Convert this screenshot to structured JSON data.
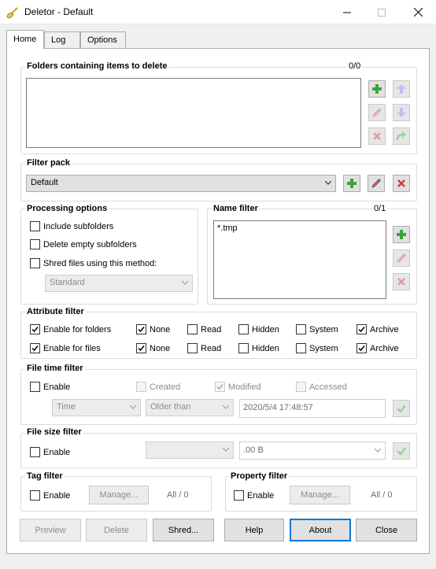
{
  "window": {
    "title": "Deletor - Default",
    "icon": "broom-icon",
    "controls": [
      "minimize-icon",
      "maximize-icon",
      "close-icon"
    ]
  },
  "tabs": [
    {
      "label": "Home",
      "active": true
    },
    {
      "label": "Log",
      "active": false
    },
    {
      "label": "Options",
      "active": false
    }
  ],
  "folders": {
    "title": "Folders containing items to delete",
    "count": "0/0",
    "items": []
  },
  "filter_pack": {
    "title": "Filter pack",
    "selected": "Default"
  },
  "processing": {
    "title": "Processing options",
    "include_subfolders": "Include subfolders",
    "delete_empty": "Delete empty subfolders",
    "shred": "Shred files using this method:",
    "method": "Standard"
  },
  "name_filter": {
    "title": "Name filter",
    "count": "0/1",
    "items": [
      "*.tmp"
    ]
  },
  "attribute_filter": {
    "title": "Attribute filter",
    "folders_label": "Enable for folders",
    "files_label": "Enable for files",
    "none": "None",
    "read": "Read",
    "hidden": "Hidden",
    "system": "System",
    "archive": "Archive"
  },
  "file_time": {
    "title": "File time filter",
    "enable": "Enable",
    "created": "Created",
    "modified": "Modified",
    "accessed": "Accessed",
    "unit": "Time",
    "comparison": "Older than",
    "datetime": "2020/5/4 17:48:57"
  },
  "file_size": {
    "title": "File size filter",
    "enable": "Enable",
    "comparison": "",
    "size": ".00 B"
  },
  "tag_filter": {
    "title": "Tag filter",
    "enable": "Enable",
    "manage": "Manage...",
    "value": "All / 0"
  },
  "property_filter": {
    "title": "Property filter",
    "enable": "Enable",
    "manage": "Manage...",
    "value": "All / 0"
  },
  "buttons": {
    "preview": "Preview",
    "delete": "Delete",
    "shred": "Shred...",
    "help": "Help",
    "about": "About",
    "close": "Close"
  },
  "colors": {
    "accent": "#0078d7",
    "add_green": "#3aa53a",
    "remove_red": "#d23c3c",
    "arrow_blue": "#8f8fe0"
  }
}
